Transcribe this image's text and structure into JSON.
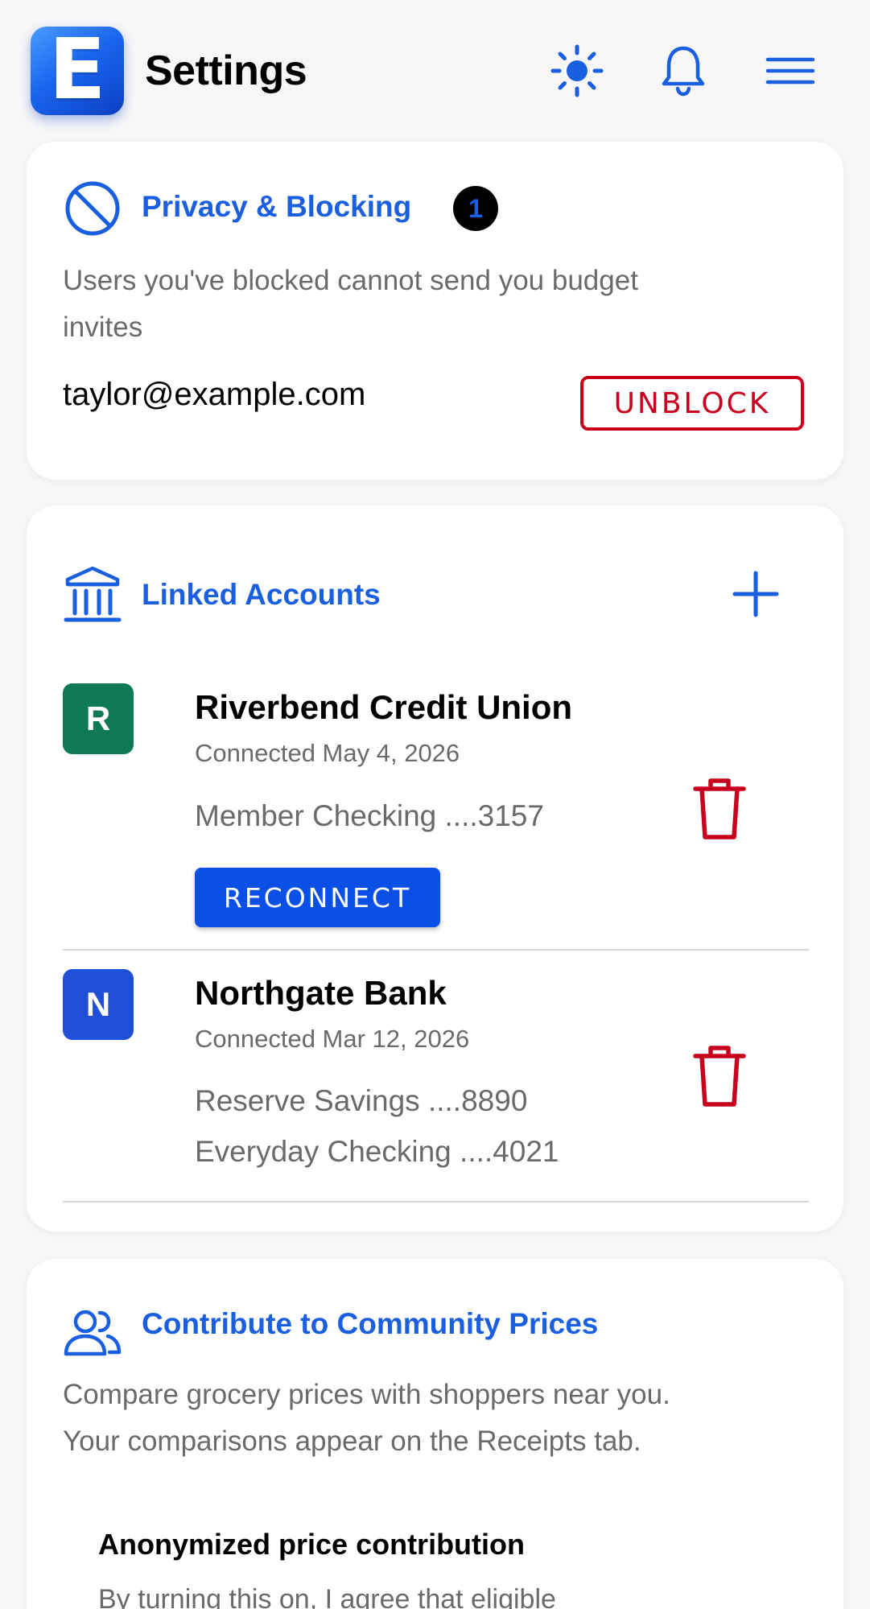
{
  "header": {
    "logo_letter": "E",
    "title": "Settings",
    "icons": [
      "sun-icon",
      "bell-icon",
      "menu-icon"
    ]
  },
  "privacy": {
    "title": "Privacy & Blocking",
    "badge_count": "1",
    "description_line1": "Users you've blocked cannot send you budget",
    "description_line2": "invites",
    "blocked_user": "taylor@example.com",
    "unblock_label": "UNBLOCK"
  },
  "linked_accounts": {
    "title": "Linked Accounts",
    "accounts": [
      {
        "initial": "R",
        "avatar_color": "#0d7a55",
        "name": "Riverbend Credit Union",
        "connected": "Connected May 4, 2026",
        "lines": [
          "Member Checking ....3157"
        ],
        "reconnect_label": "RECONNECT"
      },
      {
        "initial": "N",
        "avatar_color": "#1f4fd8",
        "name": "Northgate Bank",
        "connected": "Connected Mar 12, 2026",
        "lines": [
          "Reserve Savings ....8890",
          "Everyday Checking ....4021"
        ]
      }
    ]
  },
  "community": {
    "title": "Contribute to Community Prices",
    "description_line1": "Compare grocery prices with shoppers near you.",
    "description_line2": "Your comparisons appear on the Receipts tab.",
    "option_title": "Anonymized price contribution",
    "option_text": "By turning this on, I agree that eligible"
  },
  "colors": {
    "accent": "#1a5fe0",
    "danger": "#c8001e",
    "primary_button": "#0a4fe6"
  }
}
